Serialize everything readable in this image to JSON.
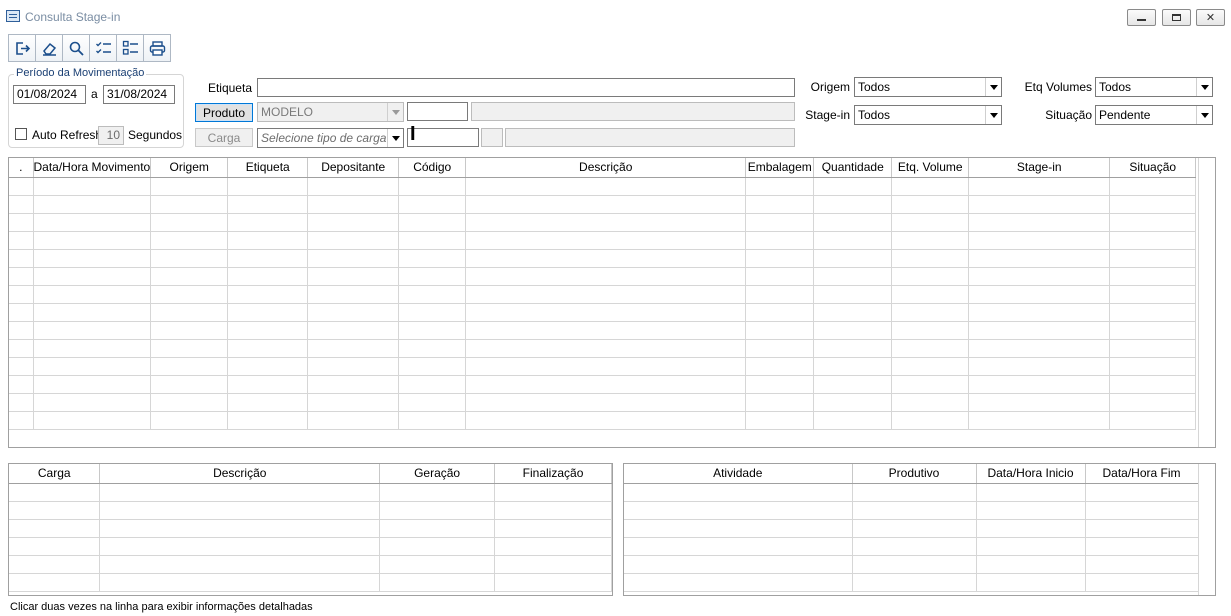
{
  "window": {
    "title": "Consulta Stage-in",
    "min_label": "▭",
    "max_label": "▣",
    "close_label": "✕"
  },
  "toolbar": {
    "icons": [
      "exit-icon",
      "eraser-icon",
      "search-icon",
      "check-list-icon",
      "list-icon",
      "print-icon"
    ]
  },
  "period": {
    "label": "Período da Movimentação",
    "from": "01/08/2024",
    "sep": "a",
    "to": "31/08/2024",
    "auto_refresh_label": "Auto Refresh",
    "seconds_value": "10",
    "seconds_label": "Segundos"
  },
  "filters": {
    "etiqueta_label": "Etiqueta",
    "etiqueta_value": "",
    "produto_button": "Produto",
    "produto_value": "MODELO",
    "produto_code": "",
    "produto_desc": "",
    "carga_button": "Carga",
    "carga_placeholder": "Selecione tipo de carga",
    "carga_field1": "",
    "carga_field2": "",
    "carga_field3": "",
    "origem_label": "Origem",
    "origem_value": "Todos",
    "stagein_label": "Stage-in",
    "stagein_value": "Todos",
    "etqvol_label": "Etq Volumes",
    "etqvol_value": "Todos",
    "situacao_label": "Situação",
    "situacao_value": "Pendente"
  },
  "main_grid": {
    "columns": [
      ".",
      "Data/Hora Movimento",
      "Origem",
      "Etiqueta",
      "Depositante",
      "Código",
      "Descrição",
      "Embalagem",
      "Quantidade",
      "Etq. Volume",
      "Stage-in",
      "Situação"
    ],
    "rows": []
  },
  "carga_grid": {
    "columns": [
      "Carga",
      "Descrição",
      "Geração",
      "Finalização"
    ],
    "rows": []
  },
  "atividade_grid": {
    "columns": [
      "Atividade",
      "Produtivo",
      "Data/Hora Inicio",
      "Data/Hora Fim"
    ],
    "rows": []
  },
  "status_text": "Clicar duas vezes na linha para exibir informações detalhadas",
  "colors": {
    "title_text": "#7a8da3",
    "group_label": "#1a3f73",
    "focus_border": "#0078d7"
  }
}
